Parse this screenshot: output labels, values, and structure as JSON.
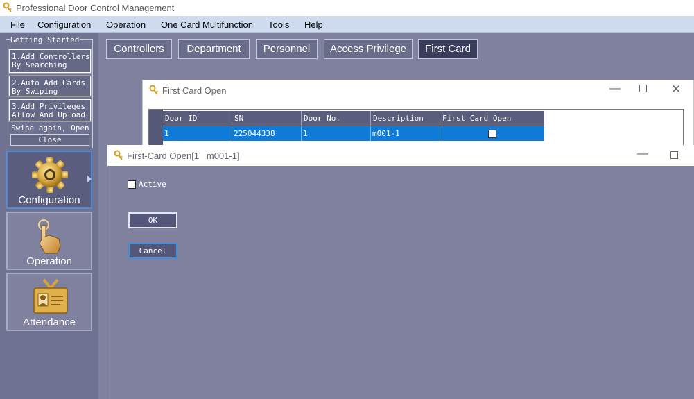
{
  "app": {
    "title": "Professional Door Control Management"
  },
  "menu": [
    "File",
    "Configuration",
    "Operation",
    "One Card Multifunction",
    "Tools",
    "Help"
  ],
  "getting_started": {
    "legend": "Getting Started",
    "steps": [
      "1.Add Controllers\nBy Searching",
      "2.Auto Add Cards\nBy Swiping",
      "3.Add Privileges\nAllow And Upload"
    ],
    "swipe_text": "Swipe again, Open",
    "close_label": "Close"
  },
  "nav_tiles": [
    {
      "label": "Configuration",
      "icon": "gear-icon",
      "active": true
    },
    {
      "label": "Operation",
      "icon": "hand-pointer-icon",
      "active": false
    },
    {
      "label": "Attendance",
      "icon": "id-card-icon",
      "active": false
    }
  ],
  "tabs": [
    {
      "label": "Controllers",
      "active": false
    },
    {
      "label": "Department",
      "active": false
    },
    {
      "label": "Personnel",
      "active": false
    },
    {
      "label": "Access Privilege",
      "active": false
    },
    {
      "label": "First Card",
      "active": true
    }
  ],
  "first_card_window": {
    "title": "First Card Open",
    "columns": [
      "Door ID",
      "SN",
      "Door No.",
      "Description",
      "First Card Open"
    ],
    "rows": [
      {
        "door_id": "1",
        "sn": "225044338",
        "door_no": "1",
        "description": "m001-1",
        "first_card_open": false
      }
    ]
  },
  "dialog": {
    "title": "First-Card Open[1   m001-1]",
    "active_label": "Active",
    "active_checked": false,
    "ok_label": "OK",
    "cancel_label": "Cancel"
  },
  "colors": {
    "accent": "#0f7ad8",
    "sidebar_bg": "#6f7290",
    "content_bg": "#7f819e",
    "menu_bg": "#cfdcf0",
    "active_tab": "#3a3c5c"
  }
}
